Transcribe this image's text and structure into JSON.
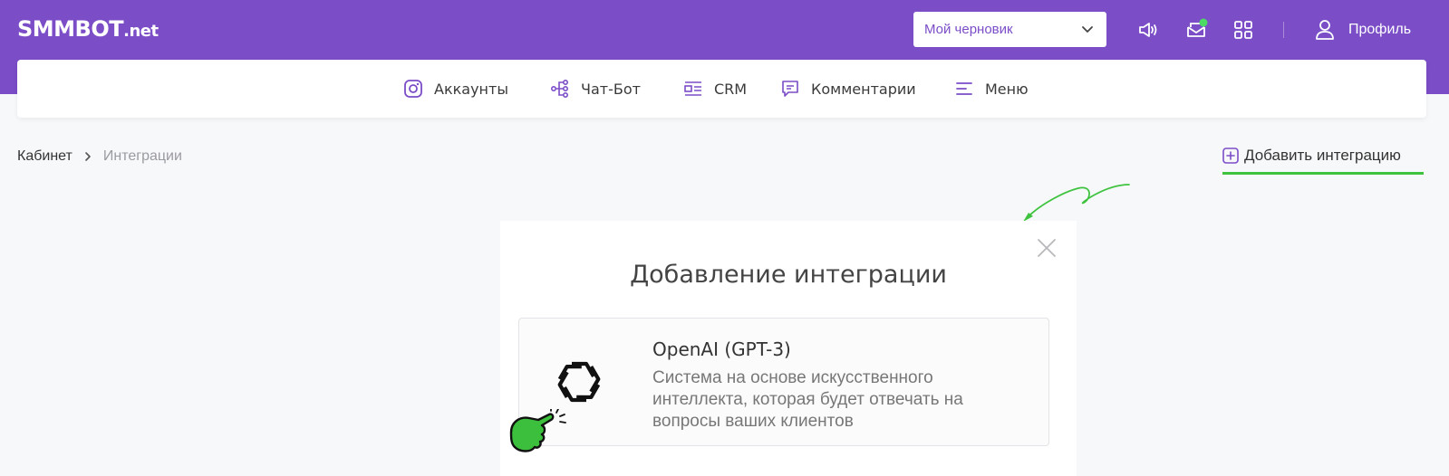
{
  "header": {
    "logo_main": "SMMBOT",
    "logo_suffix": ".net",
    "draft_select": "Мой черновик",
    "profile_label": "Профиль",
    "notification_dot_color": "#4cd964"
  },
  "nav": {
    "items": [
      {
        "label": "Аккаунты",
        "icon": "instagram-icon"
      },
      {
        "label": "Чат-Бот",
        "icon": "flow-icon"
      },
      {
        "label": "CRM",
        "icon": "crm-icon"
      },
      {
        "label": "Комментарии",
        "icon": "comment-icon"
      },
      {
        "label": "Меню",
        "icon": "menu-icon"
      }
    ]
  },
  "breadcrumb": {
    "home": "Кабинет",
    "current": "Интеграции"
  },
  "actions": {
    "add_integration": "Добавить интеграцию"
  },
  "modal": {
    "title": "Добавление интеграции",
    "card": {
      "title": "OpenAI (GPT-3)",
      "description": "Система на основе искусственного интеллекта, которая будет отвечать на вопросы ваших клиентов"
    }
  },
  "colors": {
    "brand": "#7b4dc7",
    "accent_green": "#3fc33f",
    "background": "#f7f8fa"
  }
}
